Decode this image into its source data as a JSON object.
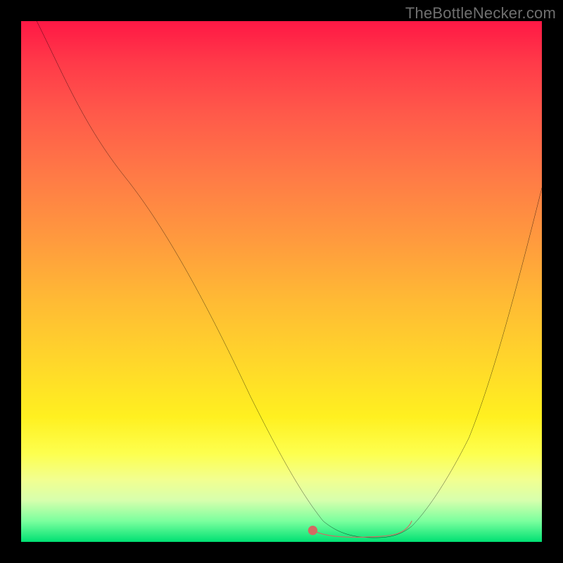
{
  "attribution": "TheBottleNecker.com",
  "colors": {
    "frame": "#000000",
    "curve": "#000000",
    "marker": "#d36a62",
    "gradient_top": "#ff1845",
    "gradient_bottom": "#00e173"
  },
  "chart_data": {
    "type": "line",
    "title": "",
    "xlabel": "",
    "ylabel": "",
    "xlim": [
      0,
      100
    ],
    "ylim": [
      0,
      100
    ],
    "series": [
      {
        "name": "bottleneck-curve",
        "x": [
          3,
          10,
          20,
          30,
          40,
          50,
          54,
          58,
          62,
          66,
          70,
          74,
          78,
          82,
          86,
          90,
          94,
          100
        ],
        "y": [
          100,
          87,
          70,
          52,
          34,
          16,
          9,
          4,
          1.5,
          0.8,
          0.8,
          1,
          3,
          9,
          18,
          30,
          44,
          68
        ]
      }
    ],
    "highlight_segment": {
      "name": "optimal-range",
      "x": [
        56,
        60,
        64,
        68,
        72,
        74,
        75
      ],
      "y": [
        2.2,
        1.2,
        0.9,
        0.8,
        1.0,
        2.2,
        4.0
      ]
    },
    "annotations": []
  }
}
